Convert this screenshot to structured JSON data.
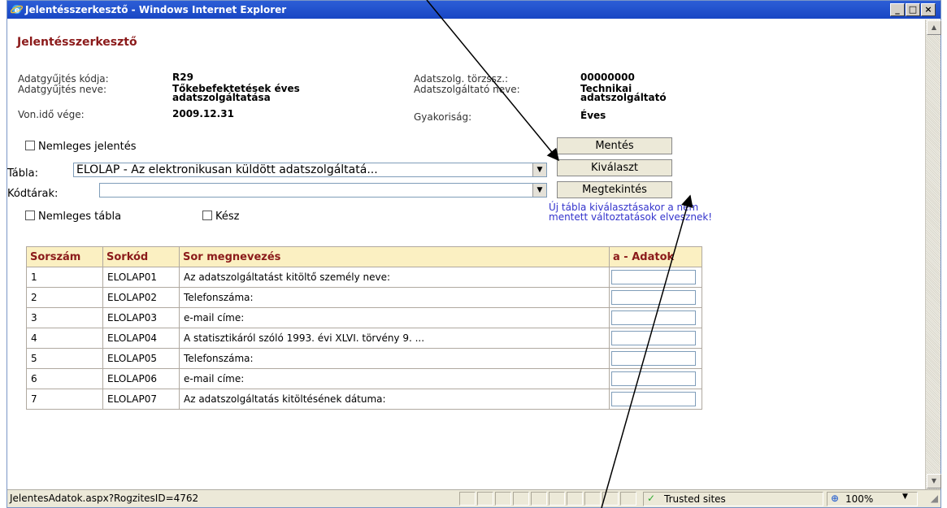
{
  "window": {
    "title": "Jelentésszerkesztő - Windows Internet Explorer"
  },
  "page": {
    "heading": "Jelentésszerkesztő"
  },
  "info": {
    "code_label": "Adatgyűjtés kódja:",
    "code_value": "R29",
    "name_label": "Adatgyűjtés neve:",
    "name_value_line1": "Tőkebefektetések éves",
    "name_value_line2": "adatszolgáltatása",
    "deadline_label": "Von.idő vége:",
    "deadline_value": "2009.12.31",
    "provider_id_label": "Adatszolg. törzssz.:",
    "provider_id_value": "00000000",
    "provider_name_label": "Adatszolgáltató neve:",
    "provider_name_line1": "Technikai",
    "provider_name_line2": "adatszolgáltató",
    "frequency_label": "Gyakoriság:",
    "frequency_value": "Éves"
  },
  "form": {
    "null_report_label": "Nemleges jelentés",
    "table_label": "Tábla:",
    "table_value": "ELOLAP - Az elektronikusan küldött adatszolgáltatá...",
    "codelist_label": "Kódtárak:",
    "codelist_value": "",
    "null_table_label": "Nemleges tábla",
    "done_label": "Kész"
  },
  "buttons": {
    "save": "Mentés",
    "select": "Kiválaszt",
    "view": "Megtekintés"
  },
  "warning": {
    "line1": "Új tábla kiválasztásakor a nem",
    "line2": "mentett változtatások elvesznek!"
  },
  "table": {
    "headers": [
      "Sorszám",
      "Sorkód",
      "Sor megnevezés",
      "a - Adatok"
    ],
    "rows": [
      {
        "num": "1",
        "code": "ELOLAP01",
        "name": "Az adatszolgáltatást kitöltő személy neve:",
        "value": ""
      },
      {
        "num": "2",
        "code": "ELOLAP02",
        "name": "Telefonszáma:",
        "value": ""
      },
      {
        "num": "3",
        "code": "ELOLAP03",
        "name": "e-mail címe:",
        "value": ""
      },
      {
        "num": "4",
        "code": "ELOLAP04",
        "name": "A statisztikáról szóló 1993. évi XLVI. törvény 9. ...",
        "value": ""
      },
      {
        "num": "5",
        "code": "ELOLAP05",
        "name": "Telefonszáma:",
        "value": ""
      },
      {
        "num": "6",
        "code": "ELOLAP06",
        "name": "e-mail címe:",
        "value": ""
      },
      {
        "num": "7",
        "code": "ELOLAP07",
        "name": "Az adatszolgáltatás kitöltésének dátuma:",
        "value": ""
      }
    ]
  },
  "status": {
    "url": "JelentesAdatok.aspx?RogzitesID=4762",
    "zone": "Trusted sites",
    "zoom": "100%"
  }
}
